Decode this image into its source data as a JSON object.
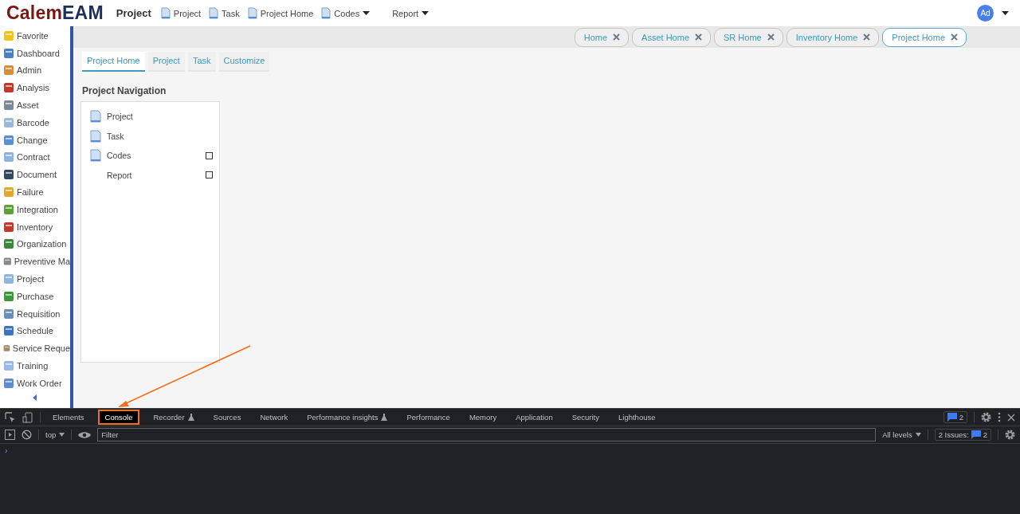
{
  "logo": {
    "part1": "Calem",
    "part2": "EAM"
  },
  "module_title": "Project",
  "top_nav": [
    {
      "label": "Project",
      "icon": true,
      "dropdown": false
    },
    {
      "label": "Task",
      "icon": true,
      "dropdown": false
    },
    {
      "label": "Project Home",
      "icon": true,
      "dropdown": false
    },
    {
      "label": "Codes",
      "icon": true,
      "dropdown": true
    },
    {
      "label": "Report",
      "icon": false,
      "dropdown": true
    }
  ],
  "user": {
    "initials": "Ad"
  },
  "sidebar": {
    "items": [
      "Favorite",
      "Dashboard",
      "Admin",
      "Analysis",
      "Asset",
      "Barcode",
      "Change",
      "Contract",
      "Document",
      "Failure",
      "Integration",
      "Inventory",
      "Organization",
      "Preventive Ma",
      "Project",
      "Purchase",
      "Requisition",
      "Schedule",
      "Service Reque",
      "Training",
      "Work Order"
    ]
  },
  "open_tabs": [
    {
      "label": "Home",
      "selected": false
    },
    {
      "label": "Asset Home",
      "selected": false
    },
    {
      "label": "SR Home",
      "selected": false
    },
    {
      "label": "Inventory Home",
      "selected": false
    },
    {
      "label": "Project Home",
      "selected": true
    }
  ],
  "page_tabs": [
    {
      "label": "Project Home",
      "selected": true
    },
    {
      "label": "Project",
      "selected": false
    },
    {
      "label": "Task",
      "selected": false
    },
    {
      "label": "Customize",
      "selected": false
    }
  ],
  "navigation": {
    "title": "Project Navigation",
    "items": [
      {
        "label": "Project",
        "icon": true,
        "expandable": false
      },
      {
        "label": "Task",
        "icon": true,
        "expandable": false
      },
      {
        "label": "Codes",
        "icon": true,
        "expandable": true
      },
      {
        "label": "Report",
        "icon": false,
        "expandable": true
      }
    ]
  },
  "devtools": {
    "tabs": [
      {
        "label": "Elements",
        "selected": false,
        "flask": false
      },
      {
        "label": "Console",
        "selected": true,
        "flask": false
      },
      {
        "label": "Recorder",
        "selected": false,
        "flask": true
      },
      {
        "label": "Sources",
        "selected": false,
        "flask": false
      },
      {
        "label": "Network",
        "selected": false,
        "flask": false
      },
      {
        "label": "Performance insights",
        "selected": false,
        "flask": true
      },
      {
        "label": "Performance",
        "selected": false,
        "flask": false
      },
      {
        "label": "Memory",
        "selected": false,
        "flask": false
      },
      {
        "label": "Application",
        "selected": false,
        "flask": false
      },
      {
        "label": "Security",
        "selected": false,
        "flask": false
      },
      {
        "label": "Lighthouse",
        "selected": false,
        "flask": false
      }
    ],
    "message_count": "2",
    "context": "top",
    "filter_placeholder": "Filter",
    "levels": "All levels",
    "issues_label": "2 Issues:",
    "issues_count": "2",
    "prompt": "›"
  }
}
